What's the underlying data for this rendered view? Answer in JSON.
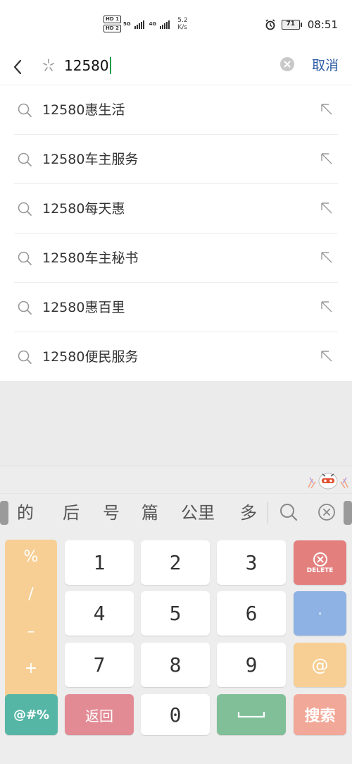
{
  "status_bar": {
    "hd1": "HD 1",
    "hd2": "HD 2",
    "net1": "5G",
    "net2": "4G",
    "speed_value": "5.2",
    "speed_unit": "K/s",
    "battery": "71",
    "time": "08:51"
  },
  "search": {
    "query": "12580",
    "cancel_label": "取消"
  },
  "suggestions": [
    {
      "text": "12580惠生活"
    },
    {
      "text": "12580车主服务"
    },
    {
      "text": "12580每天惠"
    },
    {
      "text": "12580车主秘书"
    },
    {
      "text": "12580惠百里"
    },
    {
      "text": "12580便民服务"
    }
  ],
  "keyboard": {
    "candidates": [
      "的",
      "后",
      "号",
      "篇",
      "公里",
      "多"
    ],
    "symbols": [
      "%",
      "/",
      "–",
      "+"
    ],
    "digits": [
      "1",
      "2",
      "3",
      "4",
      "5",
      "6",
      "7",
      "8",
      "9",
      "0"
    ],
    "delete_label": "DELETE",
    "dot_label": "·",
    "at_label": "@",
    "sym_switch_label": "@#%",
    "back_label": "返回",
    "search_label": "搜索"
  },
  "colors": {
    "accent_blue": "#2b5aa6",
    "cursor_green": "#1a9f4a",
    "symbol_key": "#f7cf94",
    "delete_key": "#e3807e",
    "dot_key": "#8eb2e3",
    "switch_key": "#56b6a6",
    "back_key": "#e28b95",
    "space_key": "#80bf98",
    "search_key": "#f2a898"
  },
  "icons": {
    "back": "chevron-left-icon",
    "loading": "loading-spinner-icon",
    "clear": "clear-circle-icon",
    "suggest_search": "search-icon",
    "suggest_fill": "arrow-up-left-icon",
    "alarm": "alarm-icon",
    "mascot": "mascot-icon"
  }
}
